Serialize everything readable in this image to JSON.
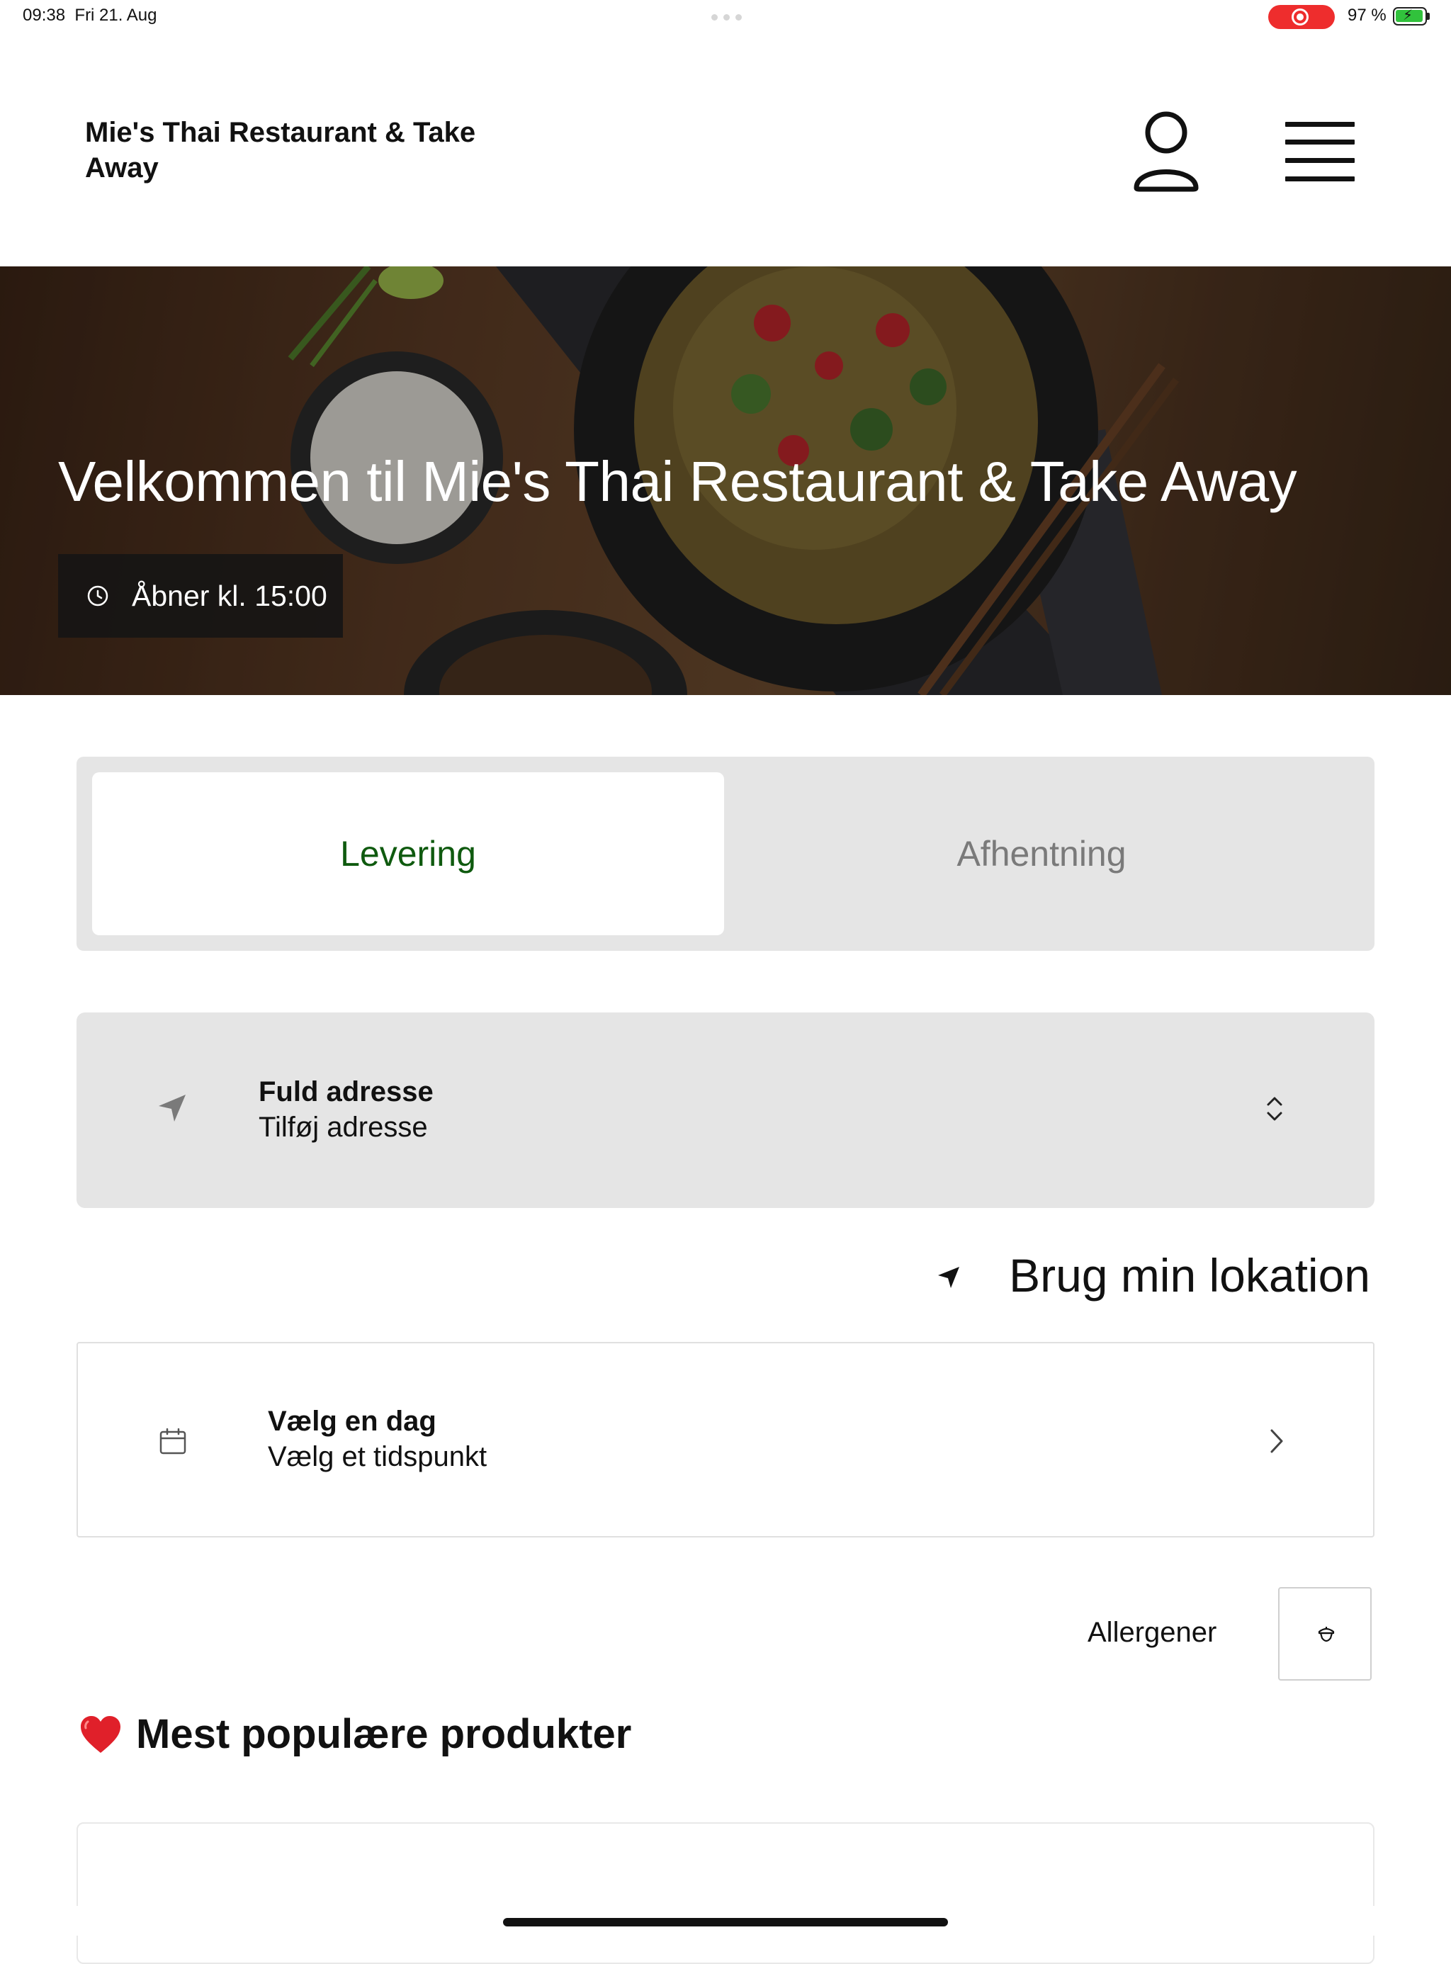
{
  "status_bar": {
    "time": "09:38",
    "date": "Fri 21. Aug",
    "battery_percent": "97 %",
    "battery_level": 0.97,
    "recording_color": "#ee2d2d"
  },
  "header": {
    "title": "Mie's Thai Restaurant & Take Away",
    "account_icon": "person-icon",
    "menu_icon": "hamburger-menu-icon"
  },
  "hero": {
    "title": "Velkommen til Mie's Thai Restaurant & Take Away",
    "hours_text": "Åbner kl. 15:00"
  },
  "fulfillment": {
    "tabs": [
      {
        "label": "Levering",
        "active": true
      },
      {
        "label": "Afhentning",
        "active": false
      }
    ],
    "active_color": "#0f5a0f"
  },
  "address": {
    "label": "Fuld adresse",
    "value": "Tilføj adresse"
  },
  "use_location": {
    "label": "Brug min lokation"
  },
  "schedule": {
    "label": "Vælg en dag",
    "value": "Vælg et tidspunkt"
  },
  "allergens": {
    "label": "Allergener"
  },
  "popular": {
    "title": "Mest populære produkter",
    "emoji": "heart"
  }
}
